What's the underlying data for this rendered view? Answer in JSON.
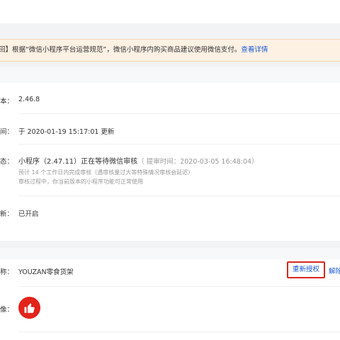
{
  "notice": {
    "text": "回】根据“微信小程序平台运营规范”，微信小程序内购买商品建议使用微信支付。",
    "link": "查看详情"
  },
  "version_section": {
    "rows": [
      {
        "label": "本：",
        "value": "2.46.8"
      },
      {
        "label": "间：",
        "value": "于 2020-01-19 15:17:01 更新"
      },
      {
        "label": "态：",
        "status_title": "小程序（2.47.11）正在等待微信审核",
        "status_time": "（ 提审时间：2020-03-05 16:48:04）",
        "notes": [
          "预计 14 个工作日内完成审核（遇审核量过大等特殊情况审核会延迟）",
          "审核过程中，你当前版本的小程序功能可正常使用"
        ]
      },
      {
        "label": "新：",
        "value": "已开启"
      }
    ]
  },
  "account_section": {
    "name_label": "称：",
    "name_value": "YOUZAN零食货架",
    "reauth_button": "重新授权",
    "unbind_button": "解除",
    "avatar_label": "像："
  },
  "colors": {
    "accent": "#1a59d6",
    "highlight_border": "#d9261c",
    "avatar_bg": "#e2231a",
    "notice_bg": "#fdf1e4"
  },
  "icons": {
    "avatar": "thumbs-up-icon"
  }
}
